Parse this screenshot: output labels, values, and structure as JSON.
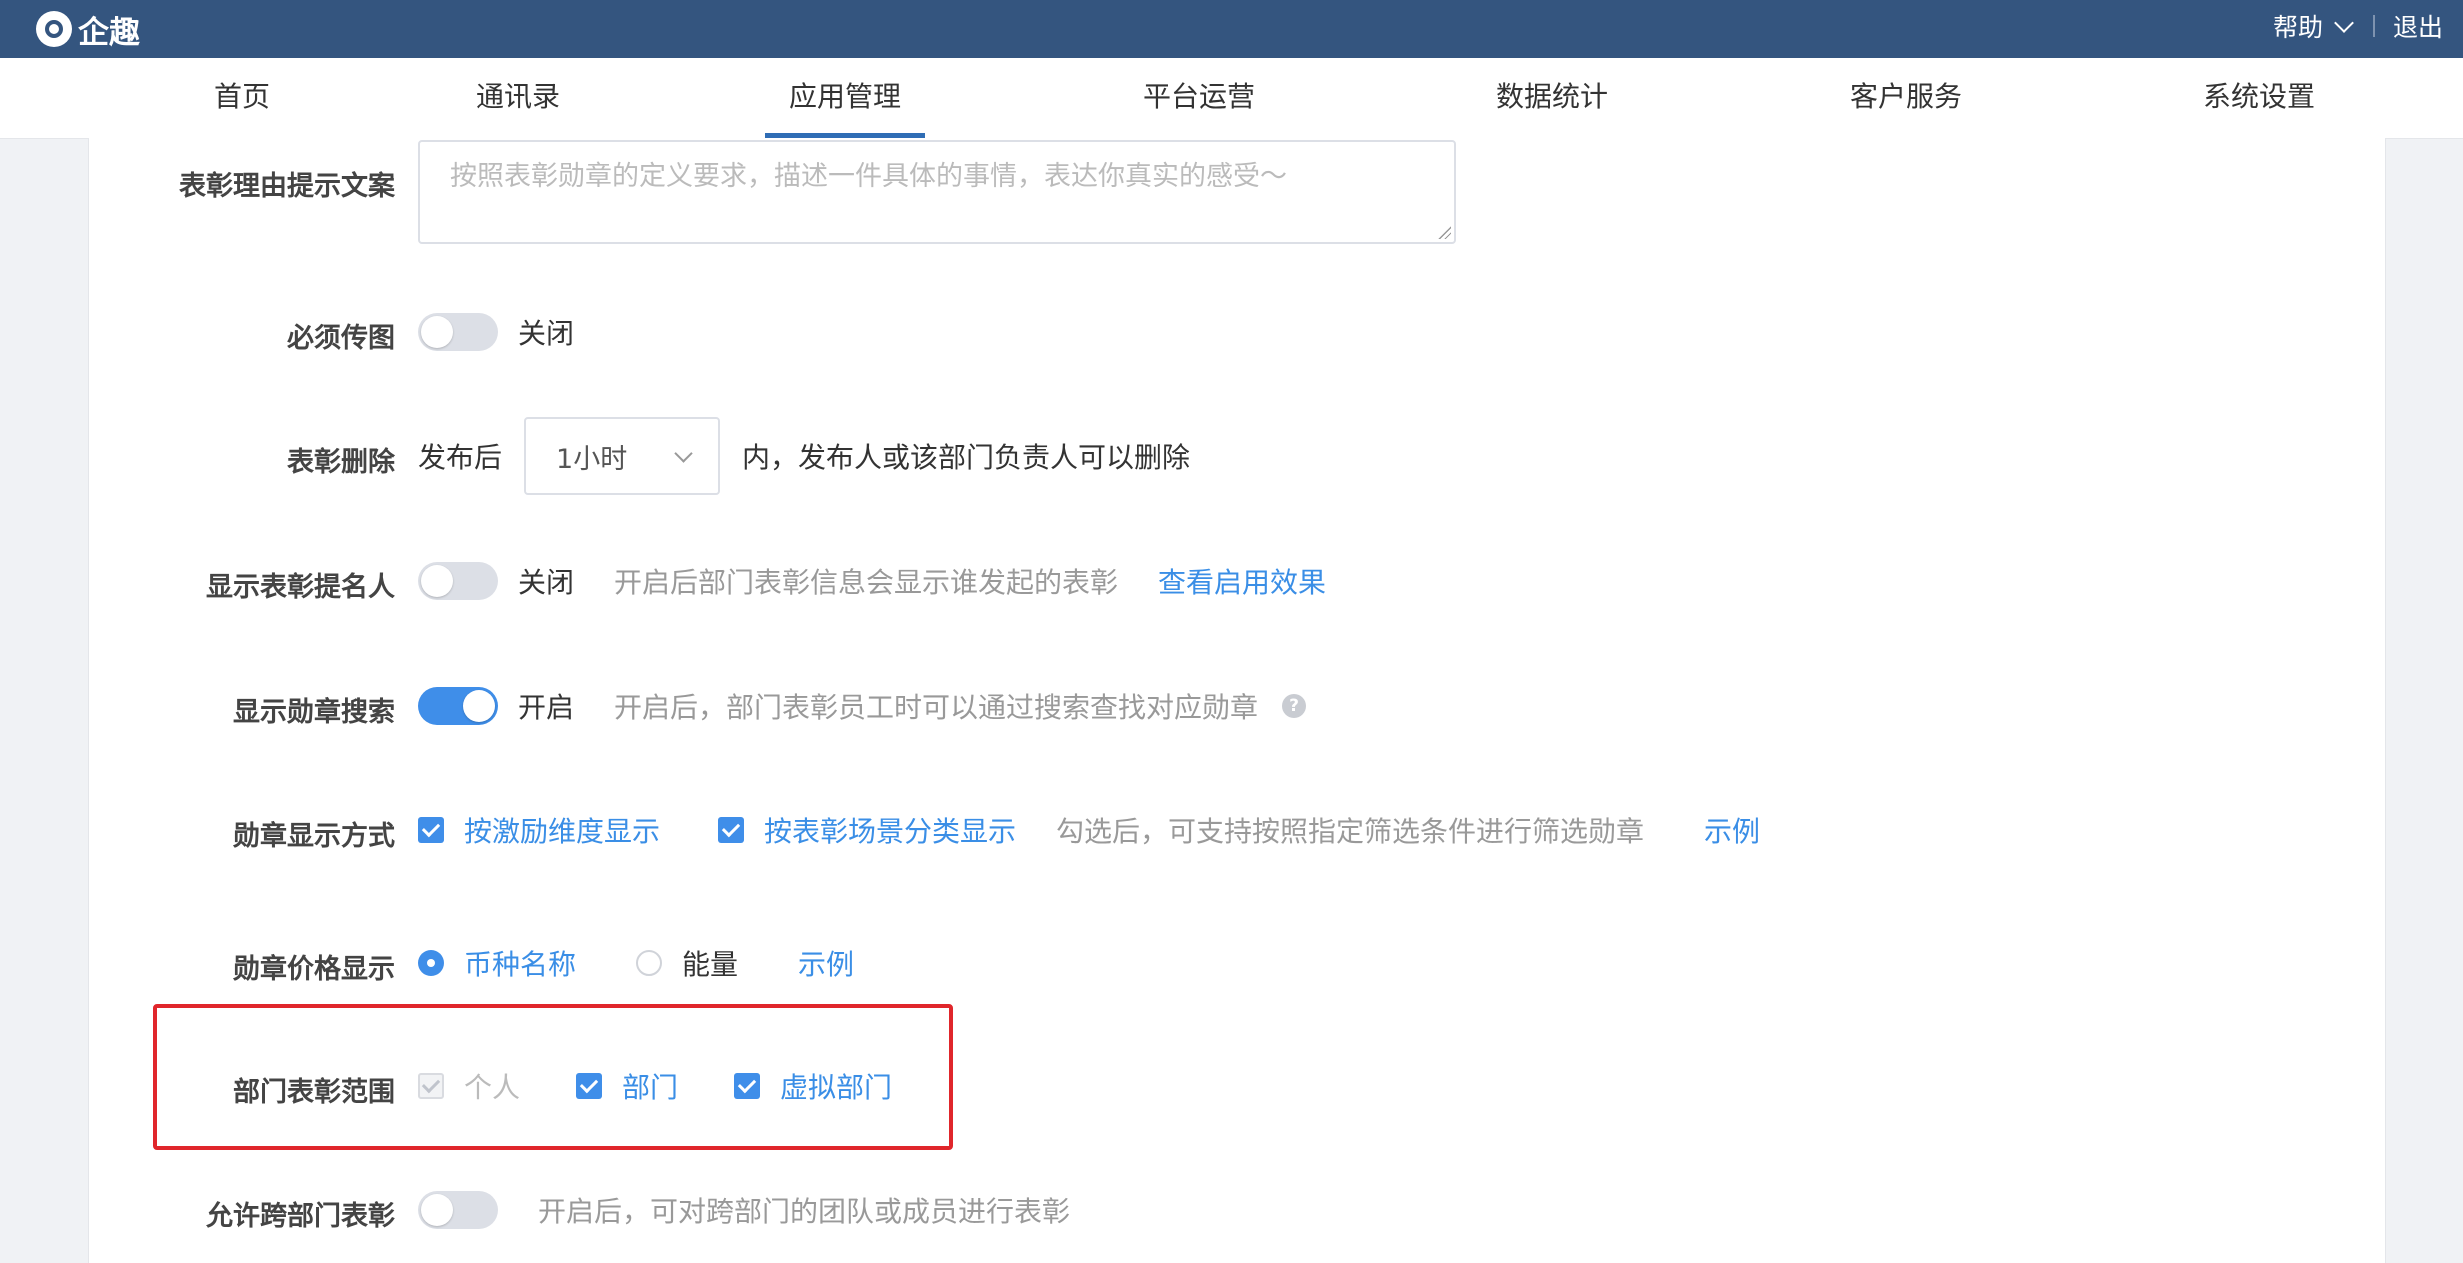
{
  "app": {
    "name": "企趣"
  },
  "header": {
    "help_label": "帮助",
    "logout_label": "退出"
  },
  "nav": {
    "items": [
      {
        "label": "首页"
      },
      {
        "label": "通讯录"
      },
      {
        "label": "应用管理"
      },
      {
        "label": "平台运营"
      },
      {
        "label": "数据统计"
      },
      {
        "label": "客户服务"
      },
      {
        "label": "系统设置"
      }
    ],
    "active": "应用管理"
  },
  "form": {
    "reason_hint": {
      "label": "表彰理由提示文案",
      "placeholder": "按照表彰勋章的定义要求，描述一件具体的事情，表达你真实的感受～"
    },
    "must_upload": {
      "label": "必须传图",
      "state": "关闭",
      "on": false
    },
    "delete": {
      "label": "表彰删除",
      "prefix": "发布后",
      "value": "1小时",
      "suffix": "内，发布人或该部门负责人可以删除"
    },
    "show_nominator": {
      "label": "显示表彰提名人",
      "state": "关闭",
      "on": false,
      "hint": "开启后部门表彰信息会显示谁发起的表彰",
      "link": "查看启用效果"
    },
    "medal_search": {
      "label": "显示勋章搜索",
      "state": "开启",
      "on": true,
      "hint": "开启后，部门表彰员工时可以通过搜索查找对应勋章",
      "help_icon": "?"
    },
    "medal_display": {
      "label": "勋章显示方式",
      "opt1": "按激励维度显示",
      "opt2": "按表彰场景分类显示",
      "hint": "勾选后，可支持按照指定筛选条件进行筛选勋章",
      "link": "示例"
    },
    "medal_price": {
      "label": "勋章价格显示",
      "opt1": "币种名称",
      "opt2": "能量",
      "selected": "币种名称",
      "link": "示例"
    },
    "scope": {
      "label": "部门表彰范围",
      "opt1": "个人",
      "opt2": "部门",
      "opt3": "虚拟部门"
    },
    "cross_dept": {
      "label": "允许跨部门表彰",
      "on": false,
      "hint": "开启后，可对跨部门的团队或成员进行表彰"
    }
  },
  "colors": {
    "header_bg": "#34557f",
    "accent": "#3f8ee9",
    "link": "#3a8ee6",
    "highlight_box": "#e0262b"
  }
}
